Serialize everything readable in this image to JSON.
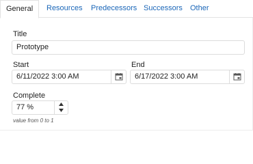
{
  "tabs": [
    {
      "label": "General",
      "active": true
    },
    {
      "label": "Resources",
      "active": false
    },
    {
      "label": "Predecessors",
      "active": false
    },
    {
      "label": "Successors",
      "active": false
    },
    {
      "label": "Other",
      "active": false
    }
  ],
  "form": {
    "title_label": "Title",
    "title_value": "Prototype",
    "start_label": "Start",
    "start_value": "6/11/2022 3:00 AM",
    "end_label": "End",
    "end_value": "6/17/2022 3:00 AM",
    "complete_label": "Complete",
    "complete_value": "77 %",
    "complete_hint": "value from 0 to 1"
  },
  "icons": {
    "calendar": "calendar-icon",
    "up": "arrow-up-icon",
    "down": "arrow-down-icon"
  },
  "colors": {
    "tab_link": "#1a66b8",
    "border": "#dcdcdc"
  }
}
